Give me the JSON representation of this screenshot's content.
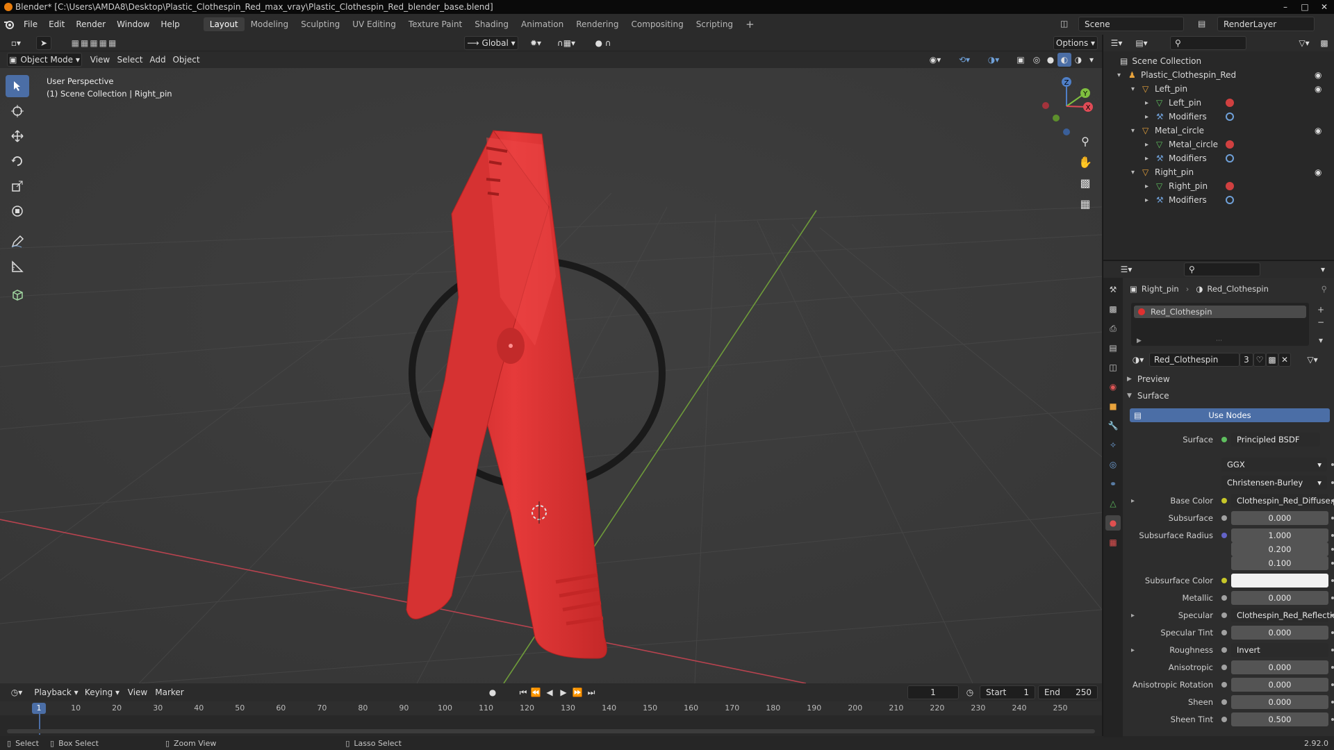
{
  "window": {
    "title": "Blender* [C:\\Users\\AMDA8\\Desktop\\Plastic_Clothespin_Red_max_vray\\Plastic_Clothespin_Red_blender_base.blend]"
  },
  "menu": [
    "File",
    "Edit",
    "Render",
    "Window",
    "Help"
  ],
  "workspaces": [
    "Layout",
    "Modeling",
    "Sculpting",
    "UV Editing",
    "Texture Paint",
    "Shading",
    "Animation",
    "Rendering",
    "Compositing",
    "Scripting"
  ],
  "scene": {
    "name": "Scene",
    "render_layer": "RenderLayer"
  },
  "viewport": {
    "transform": "Global",
    "options": "Options",
    "mode": "Object Mode",
    "menus": [
      "View",
      "Select",
      "Add",
      "Object"
    ],
    "overlay_title": "User Perspective",
    "overlay_sub": "(1) Scene Collection | Right_pin",
    "gizmo": {
      "x": "X",
      "y": "Y",
      "z": "Z"
    }
  },
  "outliner": {
    "root": "Scene Collection",
    "rows": [
      {
        "label": "Plastic_Clothespin_Red",
        "level": 0
      },
      {
        "label": "Left_pin",
        "level": 1
      },
      {
        "label": "Left_pin",
        "level": 2
      },
      {
        "label": "Modifiers",
        "level": 2
      },
      {
        "label": "Metal_circle",
        "level": 1
      },
      {
        "label": "Metal_circle",
        "level": 2
      },
      {
        "label": "Modifiers",
        "level": 2
      },
      {
        "label": "Right_pin",
        "level": 1
      },
      {
        "label": "Right_pin",
        "level": 2
      },
      {
        "label": "Modifiers",
        "level": 2
      }
    ]
  },
  "properties": {
    "breadcrumb_object": "Right_pin",
    "breadcrumb_material": "Red_Clothespin",
    "slot": "Red_Clothespin",
    "material_name": "Red_Clothespin",
    "users": "3",
    "preview": "Preview",
    "surface_panel": "Surface",
    "use_nodes": "Use Nodes",
    "surface_label": "Surface",
    "surface_shader": "Principled BSDF",
    "distribution": "GGX",
    "subsurface_method": "Christensen-Burley",
    "rows": [
      {
        "label": "Base Color",
        "value": "Clothespin_Red_Diffuse.p...",
        "type": "link",
        "dot": "#c7c729",
        "expand": true
      },
      {
        "label": "Subsurface",
        "value": "0.000",
        "type": "num",
        "dot": "#a1a1a1"
      },
      {
        "label": "Subsurface Radius",
        "value": "1.000",
        "type": "num",
        "dot": "#6363c7"
      },
      {
        "label": "",
        "value": "0.200",
        "type": "num"
      },
      {
        "label": "",
        "value": "0.100",
        "type": "num"
      },
      {
        "label": "Subsurface Color",
        "value": "",
        "type": "color",
        "dot": "#c7c729"
      },
      {
        "label": "Metallic",
        "value": "0.000",
        "type": "num",
        "dot": "#a1a1a1"
      },
      {
        "label": "Specular",
        "value": "Clothespin_Red_Reflectio...",
        "type": "link",
        "dot": "#a1a1a1",
        "expand": true
      },
      {
        "label": "Specular Tint",
        "value": "0.000",
        "type": "num",
        "dot": "#a1a1a1"
      },
      {
        "label": "Roughness",
        "value": "Invert",
        "type": "link",
        "dot": "#a1a1a1",
        "expand": true
      },
      {
        "label": "Anisotropic",
        "value": "0.000",
        "type": "num",
        "dot": "#a1a1a1"
      },
      {
        "label": "Anisotropic Rotation",
        "value": "0.000",
        "type": "num",
        "dot": "#a1a1a1"
      },
      {
        "label": "Sheen",
        "value": "0.000",
        "type": "num",
        "dot": "#a1a1a1"
      },
      {
        "label": "Sheen Tint",
        "value": "0.500",
        "type": "num",
        "dot": "#a1a1a1"
      }
    ]
  },
  "timeline": {
    "menus": [
      "Playback",
      "Keying",
      "View",
      "Marker"
    ],
    "current": "1",
    "start_label": "Start",
    "start": "1",
    "end_label": "End",
    "end": "250",
    "ticks": [
      "1",
      "10",
      "20",
      "30",
      "40",
      "50",
      "60",
      "70",
      "80",
      "90",
      "100",
      "110",
      "120",
      "130",
      "140",
      "150",
      "160",
      "170",
      "180",
      "190",
      "200",
      "210",
      "220",
      "230",
      "240",
      "250"
    ]
  },
  "status": {
    "select": "Select",
    "box_select": "Box Select",
    "zoom_view": "Zoom View",
    "lasso_select": "Lasso Select",
    "version": "2.92.0"
  },
  "colors": {
    "accent": "#4b6ea6",
    "object": "#e8e01e",
    "clothespin": "#e23a3a"
  }
}
